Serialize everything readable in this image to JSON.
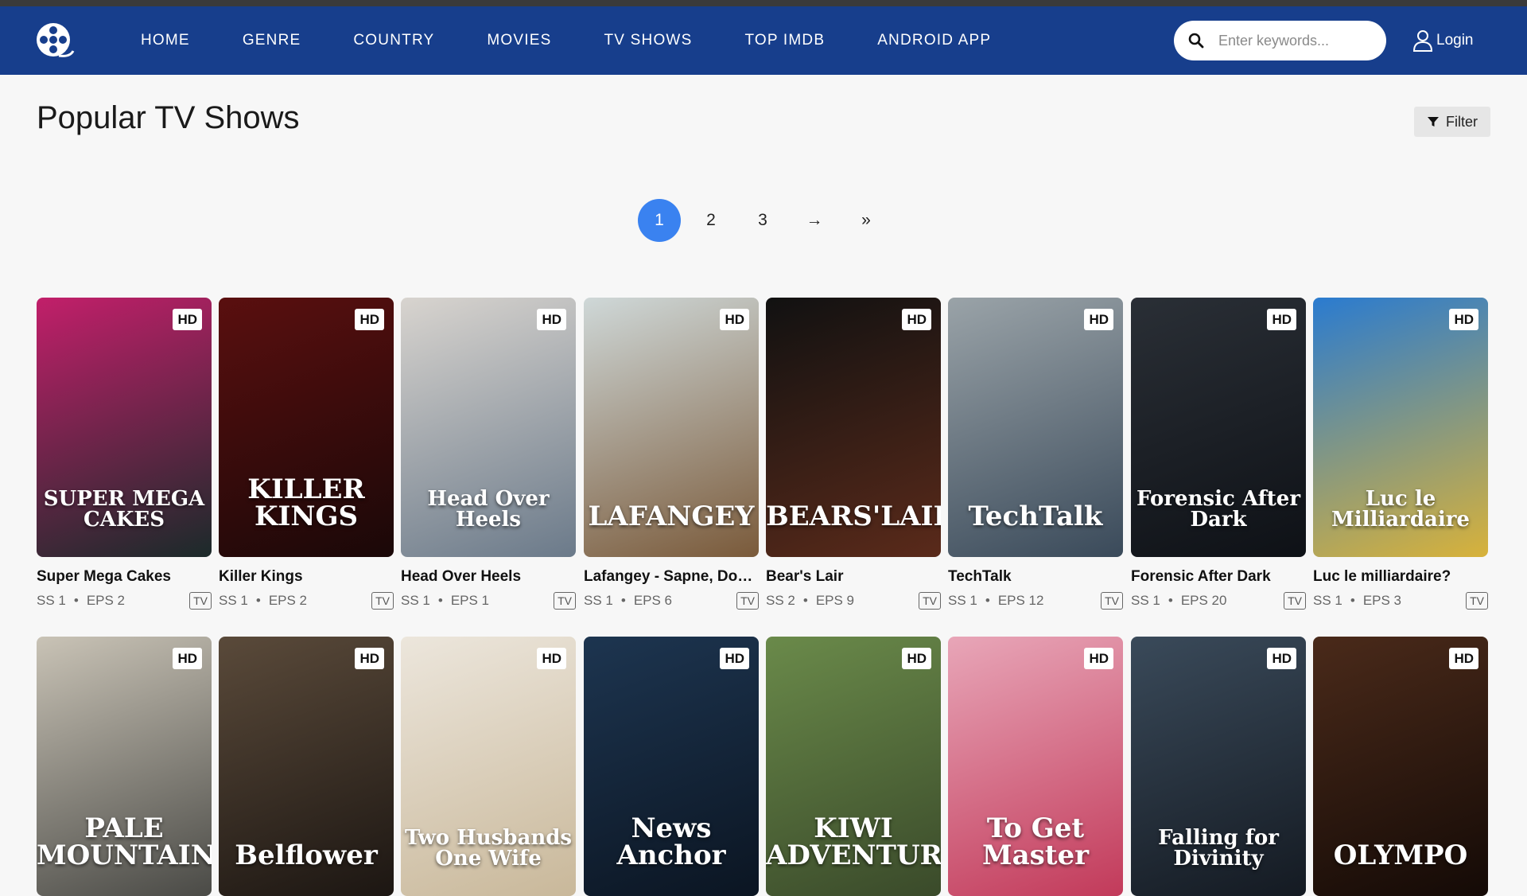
{
  "nav": {
    "items": [
      "HOME",
      "GENRE",
      "COUNTRY",
      "MOVIES",
      "TV SHOWS",
      "TOP IMDB",
      "ANDROID APP"
    ]
  },
  "search": {
    "placeholder": "Enter keywords..."
  },
  "login": {
    "label": "Login"
  },
  "page": {
    "title": "Popular TV Shows",
    "filter_label": "Filter"
  },
  "pagination": {
    "pages": [
      "1",
      "2",
      "3"
    ],
    "next": "→",
    "last": "»",
    "active": "1"
  },
  "badges": {
    "quality": "HD",
    "type": "TV"
  },
  "shows": [
    {
      "title": "Super Mega Cakes",
      "season": "SS 1",
      "episodes": "EPS 2",
      "poster_text": "SUPER MEGA CAKES",
      "colors": [
        "#c21f6a",
        "#1b2a2a"
      ]
    },
    {
      "title": "Killer Kings",
      "season": "SS 1",
      "episodes": "EPS 2",
      "poster_text": "KILLER KINGS",
      "colors": [
        "#5a0f0f",
        "#1a0808"
      ]
    },
    {
      "title": "Head Over Heels",
      "season": "SS 1",
      "episodes": "EPS 1",
      "poster_text": "Head Over Heels",
      "colors": [
        "#d8d4cf",
        "#6b7a8a"
      ]
    },
    {
      "title": "Lafangey - Sapne, Dosti, Duniya",
      "season": "SS 1",
      "episodes": "EPS 6",
      "poster_text": "LAFANGEY",
      "colors": [
        "#cfd8d8",
        "#7a5a3a"
      ]
    },
    {
      "title": "Bear's Lair",
      "season": "SS 2",
      "episodes": "EPS 9",
      "poster_text": "BEARS'LAIR",
      "colors": [
        "#111111",
        "#5a2a1a"
      ]
    },
    {
      "title": "TechTalk",
      "season": "SS 1",
      "episodes": "EPS 12",
      "poster_text": "TechTalk",
      "colors": [
        "#9aa3a8",
        "#3a4a5a"
      ]
    },
    {
      "title": "Forensic After Dark",
      "season": "SS 1",
      "episodes": "EPS 20",
      "poster_text": "Forensic After Dark",
      "colors": [
        "#2a2f36",
        "#0e1116"
      ]
    },
    {
      "title": "Luc le milliardaire?",
      "season": "SS 1",
      "episodes": "EPS 3",
      "poster_text": "Luc le Milliardaire",
      "colors": [
        "#2a7bd0",
        "#d8b23a"
      ]
    },
    {
      "title": "",
      "season": "",
      "episodes": "",
      "poster_text": "PALE MOUNTAINS",
      "colors": [
        "#c9c3b6",
        "#4a4a46"
      ]
    },
    {
      "title": "",
      "season": "",
      "episodes": "",
      "poster_text": "Belflower",
      "colors": [
        "#5a4a3a",
        "#1c1612"
      ]
    },
    {
      "title": "",
      "season": "",
      "episodes": "",
      "poster_text": "Two Husbands One Wife",
      "colors": [
        "#ece6dc",
        "#c9b89a"
      ]
    },
    {
      "title": "",
      "season": "",
      "episodes": "",
      "poster_text": "News Anchor",
      "colors": [
        "#1d3550",
        "#0b1522"
      ]
    },
    {
      "title": "",
      "season": "",
      "episodes": "",
      "poster_text": "KIWI ADVENTURE",
      "colors": [
        "#6a8a4a",
        "#3a4a2a"
      ]
    },
    {
      "title": "",
      "season": "",
      "episodes": "",
      "poster_text": "To Get Master",
      "colors": [
        "#e8a6b8",
        "#c23a5a"
      ]
    },
    {
      "title": "",
      "season": "",
      "episodes": "",
      "poster_text": "Falling for Divinity",
      "colors": [
        "#3a4a5a",
        "#141a22"
      ]
    },
    {
      "title": "",
      "season": "",
      "episodes": "",
      "poster_text": "OLYMPO",
      "colors": [
        "#4a2a1a",
        "#140a06"
      ]
    }
  ]
}
